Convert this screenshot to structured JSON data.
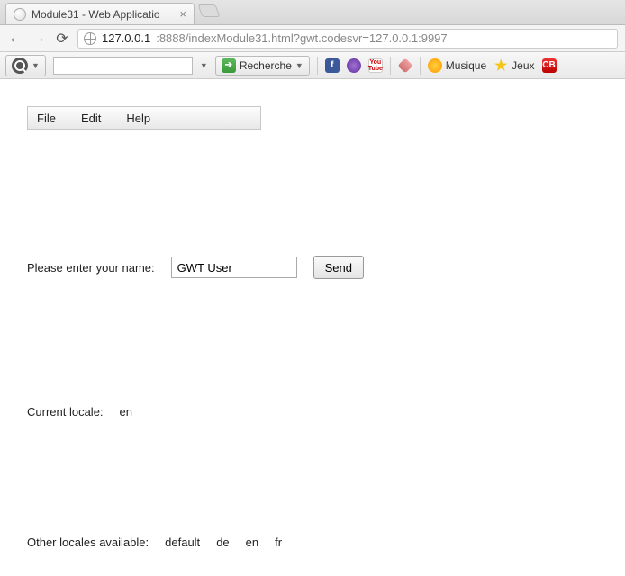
{
  "browser": {
    "tab_title": "Module31 - Web Applicatio",
    "url_host": "127.0.0.1",
    "url_port_path": ":8888/indexModule31.html?gwt.codesvr=127.0.0.1:9997",
    "toolbar": {
      "search_label": "Recherche",
      "musique_label": "Musique",
      "jeux_label": "Jeux",
      "fb": "f",
      "yt": "You\nTube",
      "cb": "CB"
    }
  },
  "menubar": {
    "file": "File",
    "edit": "Edit",
    "help": "Help"
  },
  "form": {
    "name_label": "Please enter your name:",
    "name_value": "GWT User",
    "send_label": "Send"
  },
  "locale": {
    "current_label": "Current locale:",
    "current_value": "en",
    "others_label": "Other locales available:",
    "others": [
      "default",
      "de",
      "en",
      "fr"
    ]
  }
}
